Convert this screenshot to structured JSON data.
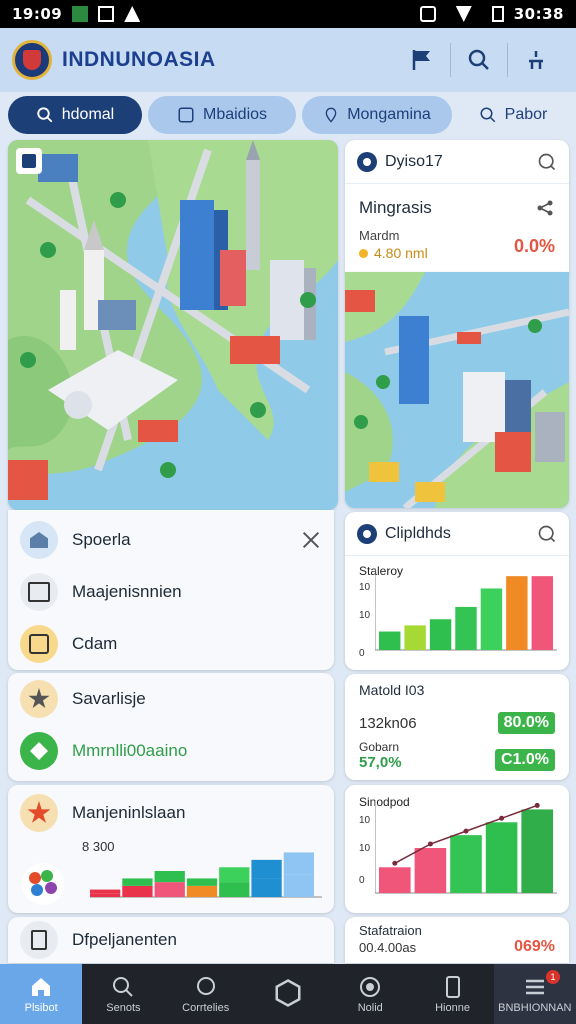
{
  "status_bar": {
    "time": "19:09",
    "right_time": "30:38"
  },
  "app": {
    "title": "INDNUNOASIA"
  },
  "tabs": [
    {
      "label": "hdomal",
      "active": true
    },
    {
      "label": "Mbaidios"
    },
    {
      "label": "Mongamina"
    },
    {
      "label": "Pabor"
    }
  ],
  "info_card": {
    "header": "Dyiso17",
    "title": "Mingrasis",
    "subtitle": "Mardm",
    "value": "4.80 nml",
    "change": "0.0%"
  },
  "menu_list": [
    {
      "label": "Spoerla"
    },
    {
      "label": "Maajenisnnien"
    },
    {
      "label": "Cdam"
    }
  ],
  "list_card_2": [
    {
      "label": "Savarlisje"
    },
    {
      "label": "Mmrnlli00aaino"
    }
  ],
  "list_card_3": {
    "label": "Manjeninlslaan",
    "value": "8 300"
  },
  "list_card_4": {
    "label": "Dfpeljanenten"
  },
  "chart_card_1": {
    "header": "Clipldhds",
    "label": "Staleroy",
    "ticks": [
      "10",
      "10",
      "0"
    ]
  },
  "stats_card": {
    "title": "Matold I03",
    "value_a": "132kn06",
    "pct_a": "80.0%",
    "label_b": "Gobarn",
    "value_b": "57,0%",
    "pct_b": "C1.0%"
  },
  "chart_card_2": {
    "label": "Sinodpod",
    "ticks": [
      "10",
      "10",
      "0"
    ]
  },
  "foot_card": {
    "title": "Stafatraion",
    "value": "00.4.00as",
    "pct": "069%"
  },
  "bottom_nav": [
    {
      "label": "Plsibot"
    },
    {
      "label": "Senots"
    },
    {
      "label": "Corrtelies"
    },
    {
      "label": ""
    },
    {
      "label": "Nolid"
    },
    {
      "label": "Hionne"
    },
    {
      "label": "BNBHIONNAN"
    }
  ],
  "notification_count": "1",
  "colors": {
    "accent": "#1d3f78",
    "appbar": "#c7dcf3",
    "green": "#3bb54a",
    "red": "#e45543"
  },
  "chart_data": [
    {
      "type": "bar",
      "title": "Staleroy",
      "categories": [
        "1",
        "2",
        "3",
        "4",
        "5",
        "6",
        "7"
      ],
      "values": [
        3,
        4,
        5,
        7,
        10,
        12,
        12
      ],
      "ylim": [
        0,
        13
      ]
    },
    {
      "type": "bar",
      "title": "Sinodpod",
      "categories": [
        "1",
        "2",
        "3",
        "4",
        "5"
      ],
      "values": [
        4,
        7,
        9,
        11,
        13
      ],
      "ylim": [
        0,
        14
      ]
    },
    {
      "type": "bar",
      "title": "Manjeninlslaan",
      "categories": [
        "1",
        "2",
        "3",
        "4",
        "5",
        "6",
        "7"
      ],
      "series": [
        {
          "values": [
            1,
            3,
            4,
            3,
            4,
            5,
            6
          ]
        },
        {
          "values": [
            1,
            2,
            3,
            2,
            4,
            5,
            6
          ]
        }
      ],
      "ylim": [
        0,
        7
      ]
    }
  ]
}
